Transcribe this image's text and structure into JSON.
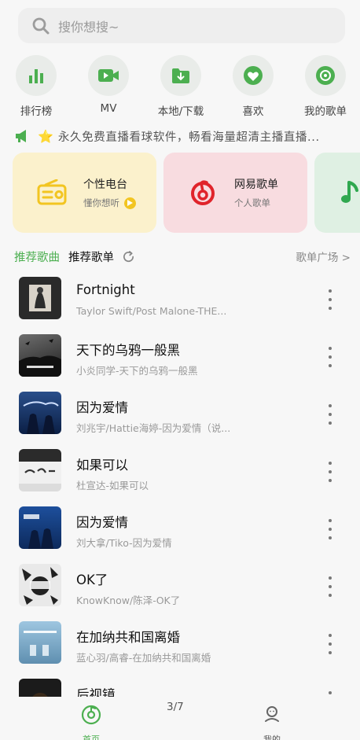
{
  "search": {
    "placeholder": "搜你想搜~"
  },
  "quick_actions": [
    {
      "label": "排行榜",
      "icon": "chart-bars-icon"
    },
    {
      "label": "MV",
      "icon": "video-camera-icon"
    },
    {
      "label": "本地/下载",
      "icon": "download-folder-icon"
    },
    {
      "label": "喜欢",
      "icon": "heart-icon"
    },
    {
      "label": "我的歌单",
      "icon": "disc-icon"
    }
  ],
  "announcement": {
    "icon": "megaphone-icon",
    "star": "⭐",
    "text": "永久免费直播看球软件，畅看海量超清主播直播..."
  },
  "cards": [
    {
      "title": "个性电台",
      "subtitle": "懂你想听",
      "icon": "radio-icon"
    },
    {
      "title": "网易歌单",
      "subtitle": "个人歌单",
      "icon": "netease-logo-icon"
    },
    {
      "title": "",
      "subtitle": "",
      "icon": "music-note-icon"
    }
  ],
  "section": {
    "tab_songs": "推荐歌曲",
    "tab_playlists": "推荐歌单",
    "more": "歌单广场 >"
  },
  "songs": [
    {
      "title": "Fortnight",
      "subtitle": "Taylor Swift/Post Malone-THE..."
    },
    {
      "title": "天下的乌鸦一般黑",
      "subtitle": "小炎同学-天下的乌鸦一般黑"
    },
    {
      "title": "因为爱情",
      "subtitle": "刘兆宇/Hattie海婷-因为爱情（说..."
    },
    {
      "title": "如果可以",
      "subtitle": "杜宣达-如果可以"
    },
    {
      "title": "因为爱情",
      "subtitle": "刘大拿/Tiko-因为爱情"
    },
    {
      "title": "OK了",
      "subtitle": "KnowKnow/陈泽-OK了"
    },
    {
      "title": "在加纳共和国离婚",
      "subtitle": "蓝心羽/高睿-在加纳共和国离婚"
    },
    {
      "title": "后视镜",
      "subtitle": ""
    }
  ],
  "bottom_nav": {
    "home": "首页",
    "pager": "3/7",
    "mine": "我的"
  },
  "colors": {
    "accent": "#4caf50",
    "radio": "#f2c521",
    "netease": "#e0242b"
  }
}
